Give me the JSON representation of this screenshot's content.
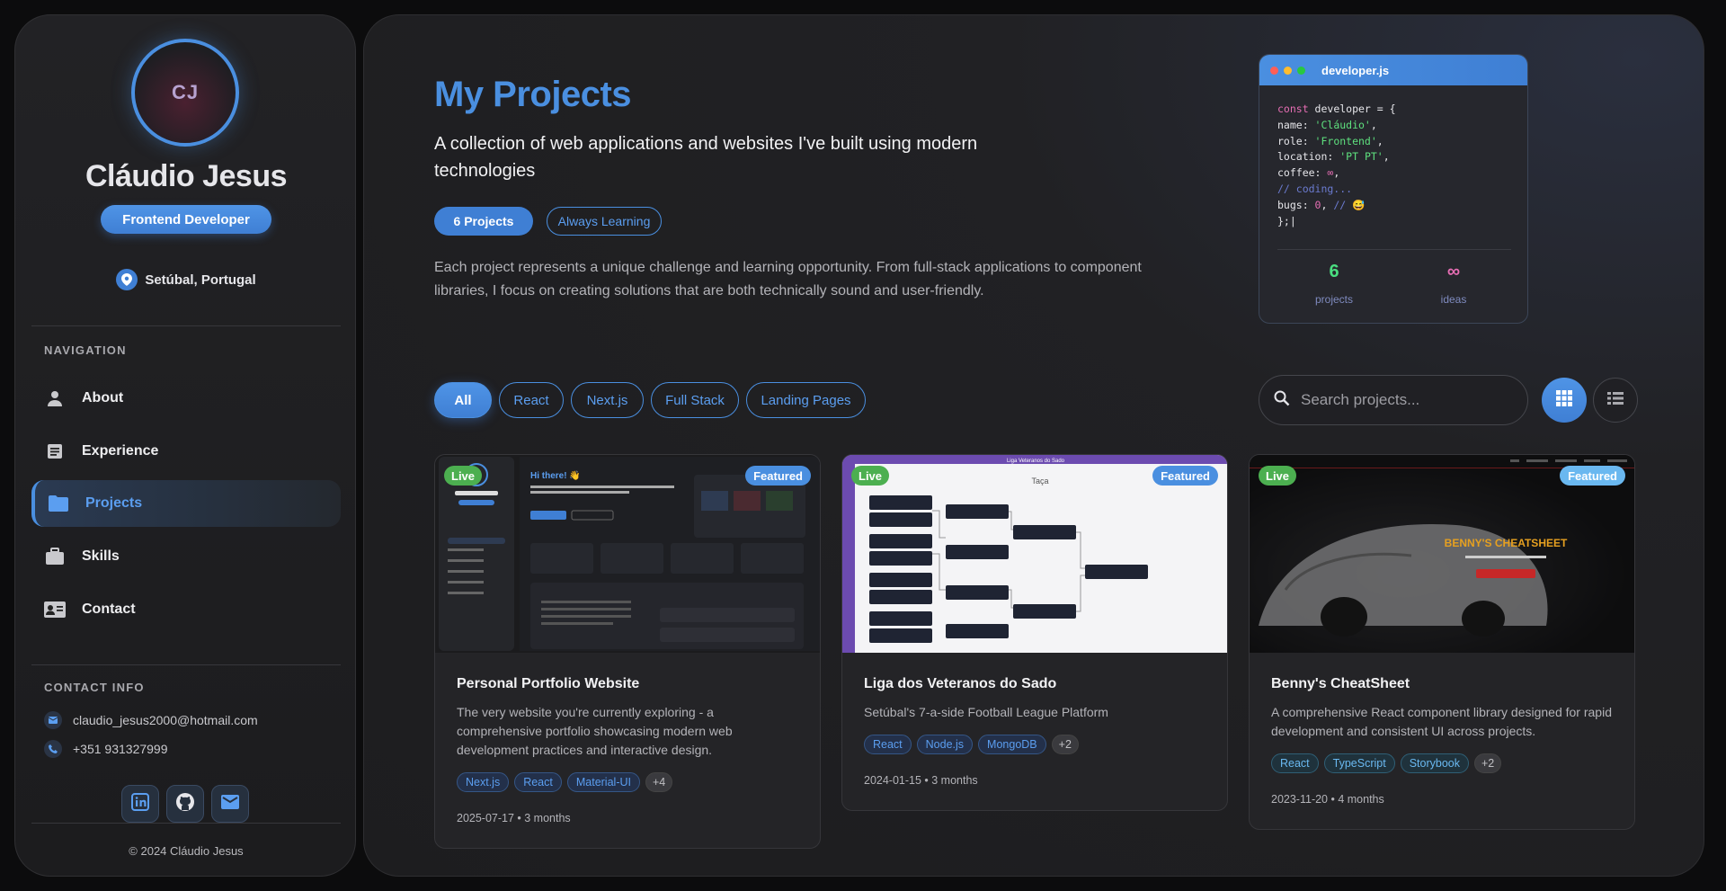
{
  "profile": {
    "initials": "CJ",
    "name": "Cláudio Jesus",
    "role": "Frontend Developer",
    "location": "Setúbal, Portugal"
  },
  "navigation": {
    "label": "NAVIGATION",
    "items": [
      {
        "label": "About",
        "icon": "person-icon"
      },
      {
        "label": "Experience",
        "icon": "document-icon"
      },
      {
        "label": "Projects",
        "icon": "folder-icon",
        "active": true
      },
      {
        "label": "Skills",
        "icon": "briefcase-icon"
      },
      {
        "label": "Contact",
        "icon": "contact-card-icon"
      }
    ]
  },
  "contact": {
    "label": "CONTACT INFO",
    "email": "claudio_jesus2000@hotmail.com",
    "phone": "+351 931327999",
    "socials": [
      "linkedin-icon",
      "github-icon",
      "mail-icon"
    ]
  },
  "footer": {
    "copyright": "© 2024 Cláudio Jesus"
  },
  "header": {
    "title": "My Projects",
    "subtitle": "A collection of web applications and websites I've built using modern technologies",
    "count_pill": "6 Projects",
    "learning_pill": "Always Learning",
    "description": "Each project represents a unique challenge and learning opportunity. From full-stack applications to component libraries, I focus on creating solutions that are both technically sound and user-friendly."
  },
  "code_card": {
    "filename": "developer.js",
    "lines": {
      "l1_kw": "const",
      "l1_rest": " developer = {",
      "l2_key": "name: ",
      "l2_val": "'Cláudio'",
      "l2_end": ",",
      "l3_key": "role: ",
      "l3_val": "'Frontend'",
      "l3_end": ",",
      "l4_key": "location: ",
      "l4_val": "'PT PT'",
      "l4_end": ",",
      "l5_key": "coffee: ",
      "l5_val": "∞",
      "l5_end": ",",
      "l6": "// coding...",
      "l7_key": "bugs: ",
      "l7_val": "0",
      "l7_end": ", ",
      "l7_cm": "// 😅",
      "l8": "};|"
    },
    "stats": [
      {
        "value": "6",
        "label": "projects",
        "color": "#4ade80"
      },
      {
        "value": "∞",
        "label": "ideas",
        "color": "#e66eb4"
      }
    ]
  },
  "filters": {
    "items": [
      "All",
      "React",
      "Next.js",
      "Full Stack",
      "Landing Pages"
    ],
    "active": "All"
  },
  "search": {
    "placeholder": "Search projects..."
  },
  "view_modes": [
    "grid-view-icon",
    "list-view-icon"
  ],
  "projects": [
    {
      "title": "Personal Portfolio Website",
      "description": "The very website you're currently exploring - a comprehensive portfolio showcasing modern web development practices and interactive design.",
      "tags": [
        "Next.js",
        "React",
        "Material-UI"
      ],
      "more": "+4",
      "date": "2025-07-17 • 3 months",
      "live": "Live",
      "featured": "Featured"
    },
    {
      "title": "Liga dos Veteranos do Sado",
      "description": "Setúbal's 7-a-side Football League Platform",
      "tags": [
        "React",
        "Node.js",
        "MongoDB"
      ],
      "more": "+2",
      "date": "2024-01-15 • 3 months",
      "live": "Live",
      "featured": "Featured"
    },
    {
      "title": "Benny's CheatSheet",
      "description": "A comprehensive React component library designed for rapid development and consistent UI across projects.",
      "tags": [
        "React",
        "TypeScript",
        "Storybook"
      ],
      "more": "+2",
      "date": "2023-11-20 • 4 months",
      "live": "Live",
      "featured": "Featured"
    }
  ],
  "thumb_texts": {
    "p1_greeting": "Hi there! 👋",
    "p2_header": "Liga Veteranos do Sado",
    "p2_round": "Taça",
    "p3_title": "BENNY'S CHEATSHEET"
  },
  "colors": {
    "accent": "#4a8fe0",
    "live": "#4caf50",
    "background": "#1d1d1f"
  }
}
